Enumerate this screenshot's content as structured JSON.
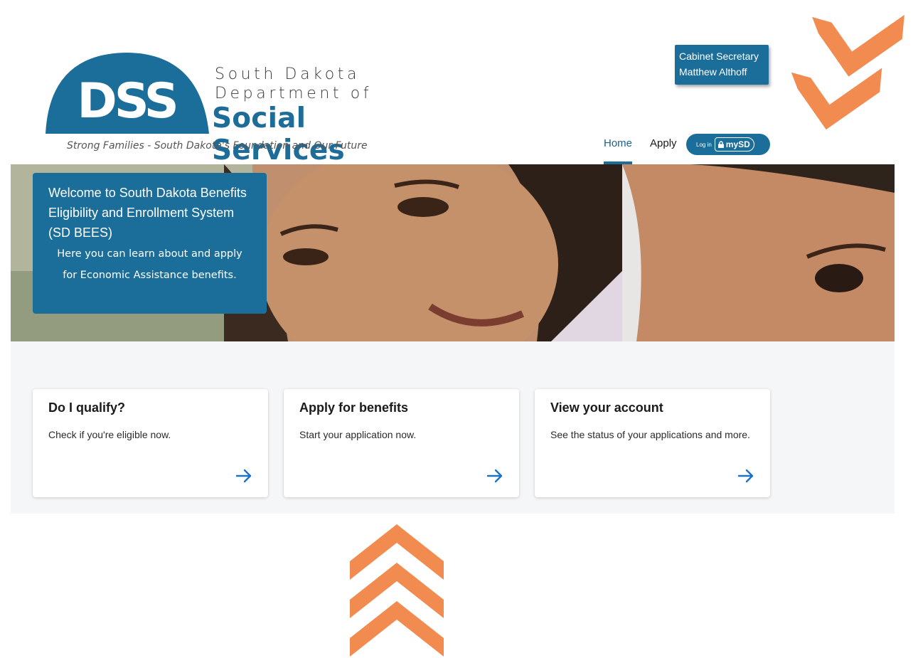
{
  "header": {
    "logo": {
      "mark": "DSS",
      "line1": "South Dakota",
      "line2": "Department of",
      "line3": "Social Services",
      "tagline": "Strong Families - South Dakota's Foundation and Our Future"
    },
    "secretary": {
      "line1": "Cabinet Secretary",
      "line2": "Matthew Althoff"
    },
    "nav": {
      "home": "Home",
      "apply": "Apply",
      "login_text": "Log in",
      "mysd": "mySD"
    }
  },
  "hero": {
    "title": "Welcome to South Dakota Benefits Eligibility and Enrollment System (SD BEES)",
    "subtitle": "Here you can learn about and apply for Economic Assistance benefits."
  },
  "cards": [
    {
      "title": "Do I qualify?",
      "description": "Check if you're eligible now."
    },
    {
      "title": "Apply for benefits",
      "description": "Start your application now."
    },
    {
      "title": "View your account",
      "description": "See the status of your applications and more."
    }
  ],
  "colors": {
    "brand_blue": "#1b6e99",
    "accent_orange": "#f28b4f",
    "link_blue": "#1a73c8"
  },
  "icons": {
    "card_arrow": "arrow-right-icon",
    "decor": "chevron-orange"
  }
}
